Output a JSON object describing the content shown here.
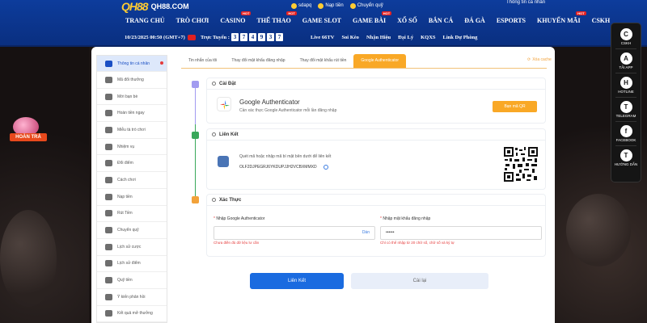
{
  "brand": {
    "logo_mark": "QH88",
    "logo_text": "QH88.COM"
  },
  "top_actions": {
    "user": "sdapq",
    "deposit": "Nạp tiền",
    "transfer": "Chuyển quỹ",
    "notice": "Thông tin cá nhân"
  },
  "nav": [
    {
      "label": "TRANG CHỦ",
      "hot": ""
    },
    {
      "label": "TRÒ CHƠI",
      "hot": ""
    },
    {
      "label": "CASINO",
      "hot": "HOT"
    },
    {
      "label": "THỂ THAO",
      "hot": "HOT"
    },
    {
      "label": "GAME SLOT",
      "hot": ""
    },
    {
      "label": "GAME BÀI",
      "hot": "HOT"
    },
    {
      "label": "XỔ SỐ",
      "hot": ""
    },
    {
      "label": "BẮN CÁ",
      "hot": ""
    },
    {
      "label": "ĐÁ GÀ",
      "hot": ""
    },
    {
      "label": "ESPORTS",
      "hot": ""
    },
    {
      "label": "KHUYẾN MÃI",
      "hot": "HOT"
    },
    {
      "label": "CSKH",
      "hot": ""
    }
  ],
  "subbar": {
    "datetime": "10/23/2025 00:50 (GMT+7)",
    "online_label": "Trực Tuyến :",
    "online_digits": [
      "3",
      "7",
      "4",
      "9",
      "3",
      "7"
    ],
    "links": [
      "Live 66TV",
      "Soi Kèo",
      "Nhận Hiệu",
      "Đại Lý",
      "KQXS",
      "Link Dự Phòng"
    ]
  },
  "sidepanel": [
    {
      "icon": "C",
      "label": "CSKH"
    },
    {
      "icon": "A",
      "label": "TẢI APP"
    },
    {
      "icon": "H",
      "label": "HOTLINE"
    },
    {
      "icon": "T",
      "label": "TELEGRAM"
    },
    {
      "icon": "f",
      "label": "FACEBOOK"
    },
    {
      "icon": "T",
      "label": "HƯỚNG DẪN"
    }
  ],
  "promo": {
    "label": "HOÀN TRẢ"
  },
  "left_menu": [
    "Thông tin cá nhân",
    "Mã đổi thưởng",
    "Mời bạn bè",
    "Hoàn tiền ngay",
    "Miễu tà trò chơi",
    "Nhiệm vụ",
    "Đổi điểm",
    "Cách chơi",
    "Nạp tiền",
    "Rút Tiền",
    "Chuyển quỹ",
    "Lịch sử cược",
    "Lịch sử điểm",
    "Quỹ tiền",
    "Ý kiến phản hồi",
    "Kết quả mở thưởng"
  ],
  "tabs": [
    {
      "label": "Tin nhắn của tôi",
      "active": false
    },
    {
      "label": "Thay đổi mật khẩu đăng nhập",
      "active": false
    },
    {
      "label": "Thay đổi mật khẩu rút tiền",
      "active": false
    },
    {
      "label": "Google Authenticator",
      "active": true
    }
  ],
  "logout_label": "Xóa cache",
  "sections": {
    "setup": {
      "title": "Cài Đặt",
      "app_name": "Google Authenticator",
      "app_desc": "Cần xác thực Google Authenticator mỗi lần đăng nhập",
      "button": "Bạn mã QR"
    },
    "link": {
      "title": "Liên Kết",
      "desc": "Quét mã hoặc nhập mã bí mật bên dưới để liên kết",
      "code": "OLF2DJPEGRJ6YKDUPJJH2VCBXMMXD"
    },
    "verify": {
      "title": "Xác Thực",
      "ga_label": "Nhập Google Authenticator",
      "ga_paste": "Dán",
      "ga_error": "Chưa điền đủ dữ liệu lư cần",
      "pw_label": "Nhập mật khẩu đăng nhập",
      "pw_value": "••••••",
      "pw_error": "Chỉ có thể nhập từ 20 chữ số, chữ số và ký tự"
    }
  },
  "buttons": {
    "confirm": "Liên Kết",
    "reset": "Cài lại"
  },
  "colors": {
    "nav_blue": "#0d3c9c",
    "accent_orange": "#f9a826",
    "primary_blue": "#1a6be0"
  }
}
